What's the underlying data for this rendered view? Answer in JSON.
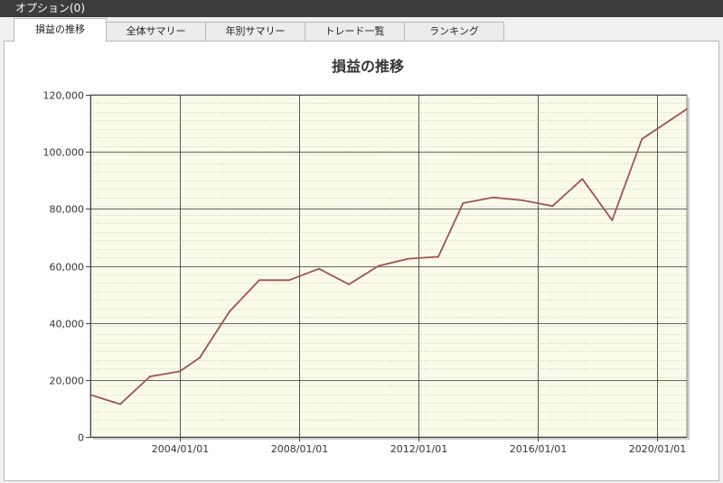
{
  "window": {
    "title": "オプション(0)"
  },
  "tabs": [
    {
      "label": "損益の推移",
      "active": true
    },
    {
      "label": "全体サマリー",
      "active": false
    },
    {
      "label": "年別サマリー",
      "active": false
    },
    {
      "label": "トレード一覧",
      "active": false
    },
    {
      "label": "ランキング",
      "active": false
    }
  ],
  "colors": {
    "line": "#a0524e",
    "plot_bg": "#fbfbea",
    "major_grid": "#333333",
    "minor_grid": "#999999"
  },
  "chart_data": {
    "type": "line",
    "title": "損益の推移",
    "xlabel": "",
    "ylabel": "",
    "ylim": [
      0,
      120000
    ],
    "xlim": [
      "2001/01/01",
      "2021/01/01"
    ],
    "y_ticks": [
      "0",
      "20,000",
      "40,000",
      "60,000",
      "80,000",
      "100,000",
      "120,000"
    ],
    "x_ticks": [
      "2004/01/01",
      "2008/01/01",
      "2012/01/01",
      "2016/01/01",
      "2020/01/01"
    ],
    "grid": true,
    "series": [
      {
        "x": [
          "2001/01/01",
          "2002/01/01",
          "2003/01/01",
          "2004/01/01",
          "2004/09/01",
          "2005/09/01",
          "2006/09/01",
          "2007/09/01",
          "2008/09/01",
          "2009/09/01",
          "2010/09/01",
          "2011/09/01",
          "2012/09/01",
          "2013/07/01",
          "2014/07/01",
          "2015/07/01",
          "2016/07/01",
          "2017/07/01",
          "2018/07/01",
          "2019/07/01",
          "2021/01/01"
        ],
        "values": [
          14800,
          11500,
          21200,
          23000,
          27800,
          44000,
          55000,
          55000,
          59000,
          53500,
          60000,
          62500,
          63200,
          82000,
          84000,
          83000,
          81000,
          90500,
          76000,
          104500,
          115000
        ]
      }
    ]
  }
}
